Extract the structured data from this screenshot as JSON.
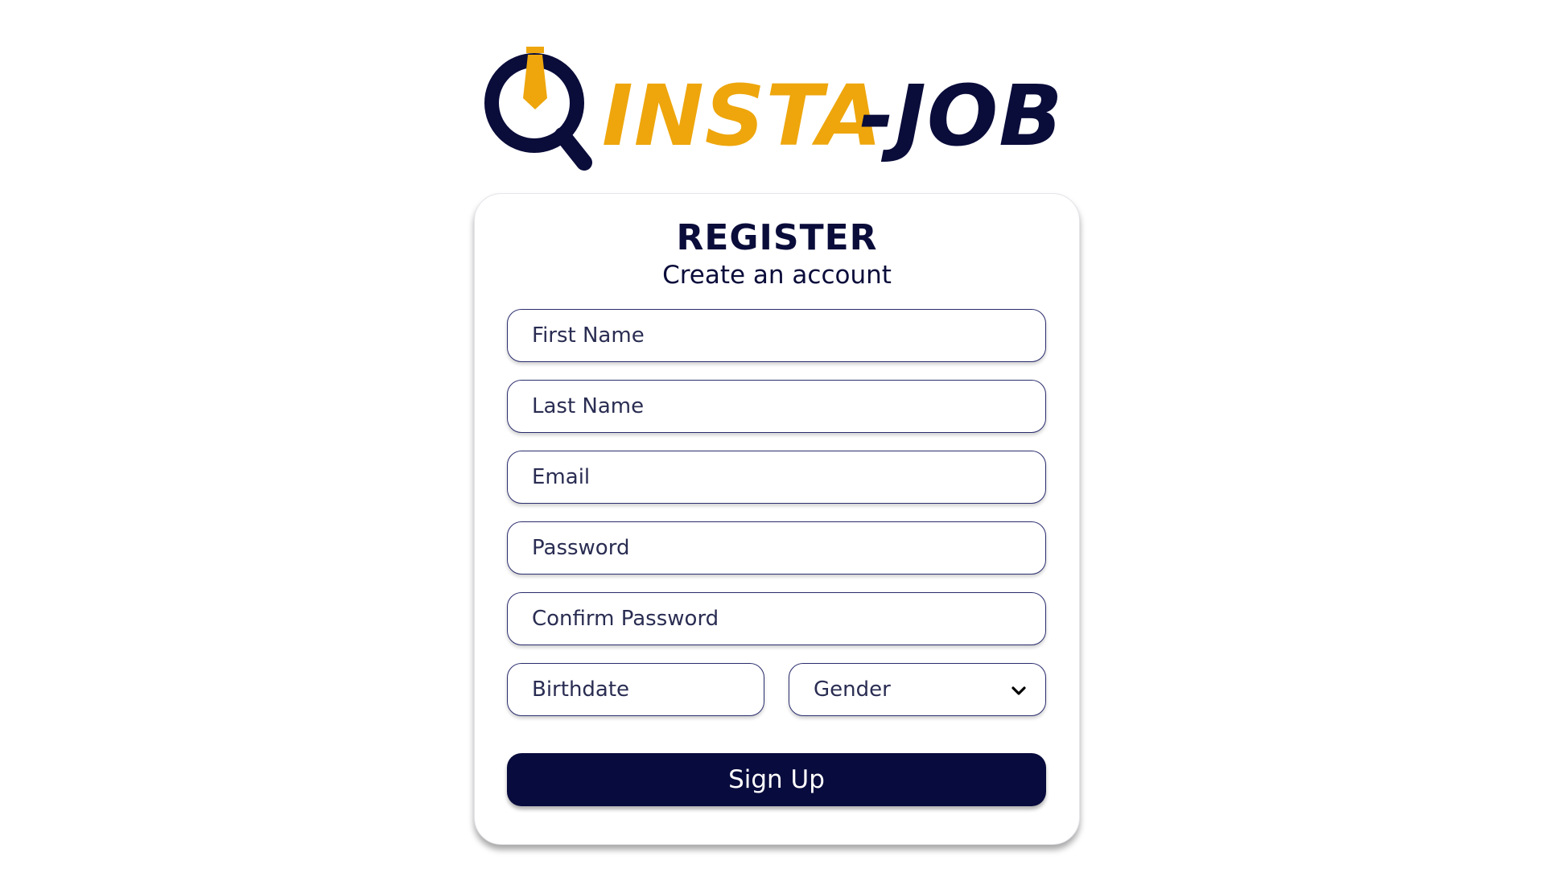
{
  "logo": {
    "part1": "INSTA",
    "part2": "-JOB",
    "colors": {
      "gold": "#eea60c",
      "navy": "#0a0c3a"
    }
  },
  "card": {
    "title": "REGISTER",
    "subtitle": "Create an account"
  },
  "form": {
    "first_name_placeholder": "First Name",
    "last_name_placeholder": "Last Name",
    "email_placeholder": "Email",
    "password_placeholder": "Password",
    "confirm_password_placeholder": "Confirm Password",
    "birthdate_placeholder": "Birthdate",
    "gender_selected": "Gender",
    "signup_label": "Sign Up"
  },
  "colors": {
    "accent": "#eea60c",
    "primary": "#080b3d",
    "border": "#2a2d6e"
  }
}
